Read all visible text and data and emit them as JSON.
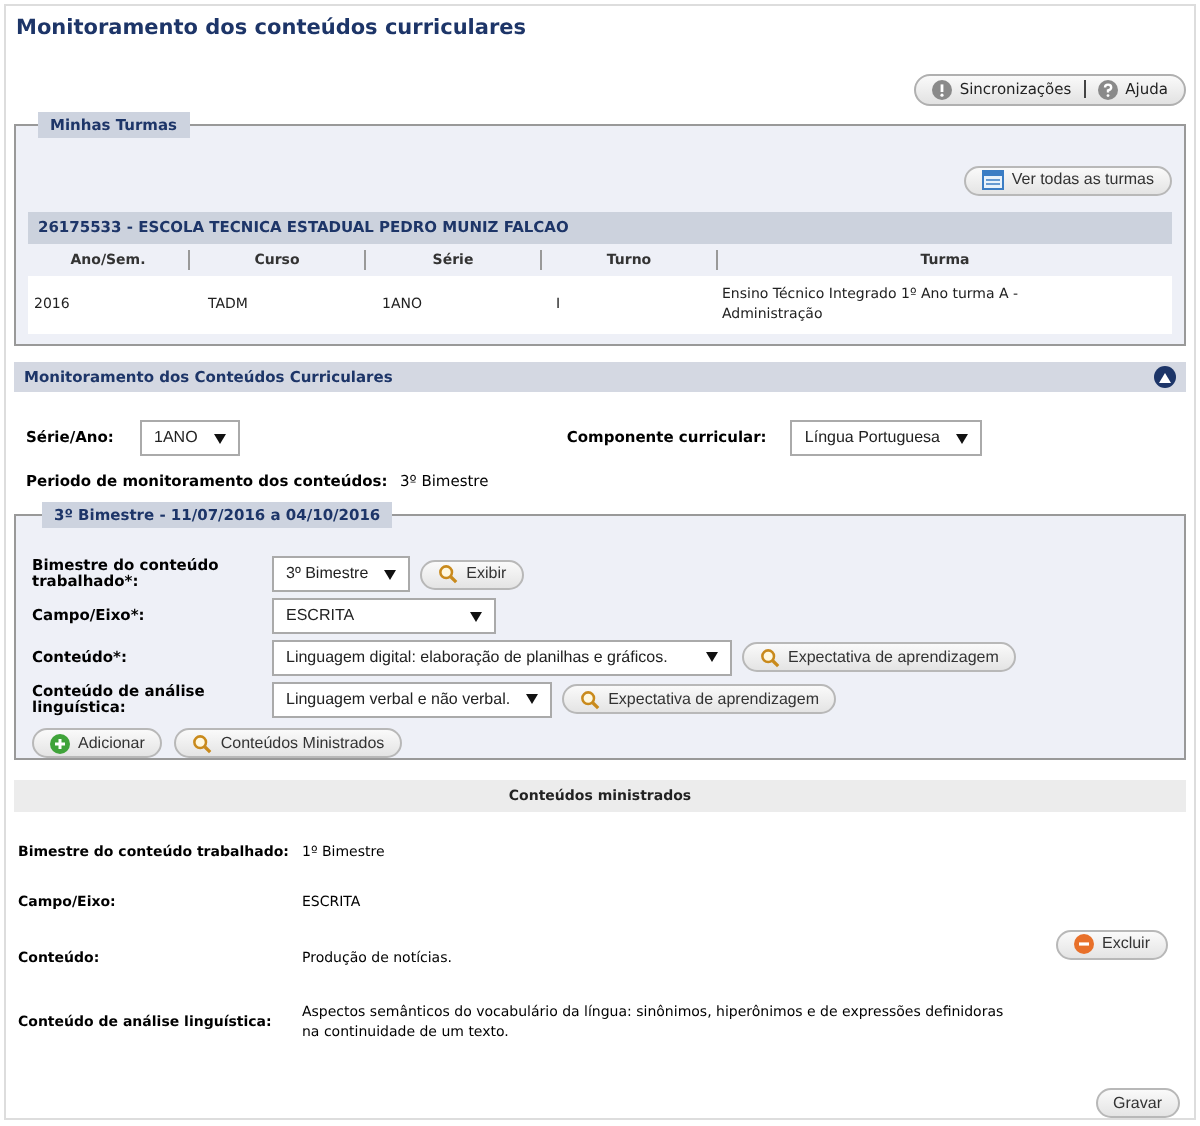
{
  "page": {
    "title": "Monitoramento dos conteúdos curriculares"
  },
  "toolbar": [
    {
      "label": "Sincronizações"
    },
    {
      "label": "Ajuda"
    }
  ],
  "minhas_turmas": {
    "legend": "Minhas Turmas",
    "button": {
      "label": "Ver todas as turmas"
    },
    "school": "26175533 - ESCOLA TECNICA ESTADUAL PEDRO MUNIZ FALCAO",
    "columns": [
      "Ano/Sem.",
      "Curso",
      "Série",
      "Turno",
      "Turma"
    ],
    "rows": [
      [
        "2016",
        "TADM",
        "1ANO",
        "I",
        "Ensino Técnico Integrado 1º Ano turma A - Administração"
      ]
    ]
  },
  "monitoramento": {
    "title": "Monitoramento dos Conteúdos Curriculares",
    "expanded": true,
    "serie": {
      "label": "Série/Ano:",
      "value": "1ANO"
    },
    "componente": {
      "label": "Componente curricular:",
      "value": "Língua Portuguesa"
    },
    "periodo": {
      "label": "Periodo de monitoramento dos conteúdos:",
      "value": "3º Bimestre"
    },
    "bimestre_panel": {
      "legend": "3º Bimestre - 11/07/2016 a 04/10/2016",
      "fields": [
        {
          "label": "Bimestre do conteúdo trabalhado*:",
          "value": "3º Bimestre",
          "button": {
            "label": "Exibir"
          }
        },
        {
          "label": "Campo/Eixo*:",
          "value": "ESCRITA"
        },
        {
          "label": "Conteúdo*:",
          "value": "Linguagem digital: elaboração de planilhas e gráficos.",
          "button": {
            "label": "Expectativa de aprendizagem"
          }
        },
        {
          "label": "Conteúdo de análise linguística:",
          "value": "Linguagem verbal e não verbal.",
          "button": {
            "label": "Expectativa de aprendizagem"
          }
        }
      ],
      "actions": [
        {
          "label": "Adicionar"
        },
        {
          "label": "Conteúdos Ministrados"
        }
      ]
    }
  },
  "ministrados": {
    "title": "Conteúdos ministrados",
    "rows": [
      {
        "label": "Bimestre do conteúdo trabalhado:",
        "value": "1º Bimestre"
      },
      {
        "label": "Campo/Eixo:",
        "value": "ESCRITA"
      },
      {
        "label": "Conteúdo:",
        "value": "Produção de notícias."
      },
      {
        "label": "Conteúdo de análise linguística:",
        "value": "Aspectos semânticos do vocabulário da língua: sinônimos, hiperônimos e de expressões definidoras na continuidade de um texto."
      }
    ],
    "delete_button": {
      "label": "Excluir"
    },
    "save_button": {
      "label": "Gravar"
    }
  }
}
